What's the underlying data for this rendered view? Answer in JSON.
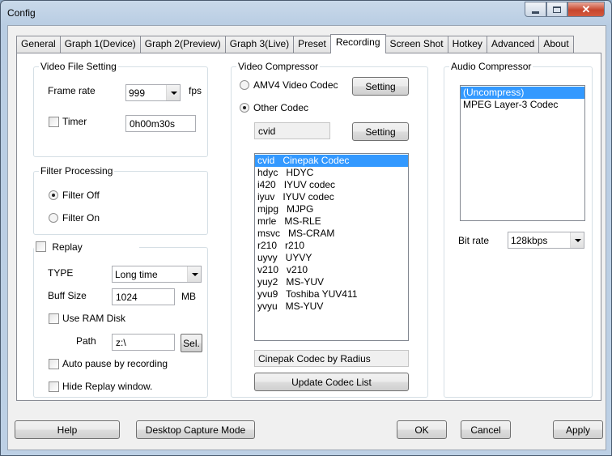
{
  "window": {
    "title": "Config",
    "close_glyph": "✕",
    "colors": {
      "selection": "#3399ff",
      "close_button": "#c7462d"
    }
  },
  "tabs": [
    {
      "label": "General"
    },
    {
      "label": "Graph 1(Device)"
    },
    {
      "label": "Graph 2(Preview)"
    },
    {
      "label": "Graph 3(Live)"
    },
    {
      "label": "Preset"
    },
    {
      "label": "Recording"
    },
    {
      "label": "Screen Shot"
    },
    {
      "label": "Hotkey"
    },
    {
      "label": "Advanced"
    },
    {
      "label": "About"
    }
  ],
  "video_file": {
    "title": "Video File Setting",
    "frame_rate_label": "Frame rate",
    "frame_rate_value": "999",
    "fps_label": "fps",
    "timer_label": "Timer",
    "timer_checked": false,
    "timer_value": "0h00m30s"
  },
  "filter": {
    "title": "Filter Processing",
    "off_label": "Filter Off",
    "on_label": "Filter On",
    "selected": "off"
  },
  "replay": {
    "title": "Replay",
    "checked": false,
    "type_label": "TYPE",
    "type_value": "Long time",
    "buff_label": "Buff Size",
    "buff_value": "1024",
    "buff_unit": "MB",
    "ram_disk_label": "Use RAM Disk",
    "path_label": "Path",
    "path_value": "z:\\",
    "sel_label": "Sel.",
    "auto_pause_label": "Auto pause by recording",
    "hide_label": "Hide Replay window."
  },
  "video_compressor": {
    "title": "Video Compressor",
    "amv4_label": "AMV4 Video Codec",
    "other_label": "Other Codec",
    "selected": "other",
    "setting1": "Setting",
    "setting2": "Setting",
    "codec_value": "cvid",
    "codecs": [
      "cvid   Cinepak Codec",
      "hdyc   HDYC",
      "i420   IYUV codec",
      "iyuv   IYUV codec",
      "mjpg   MJPG",
      "mrle   MS-RLE",
      "msvc   MS-CRAM",
      "r210   r210",
      "uyvy   UYVY",
      "v210   v210",
      "yuy2   MS-YUV",
      "yvu9   Toshiba YUV411",
      "yvyu   MS-YUV"
    ],
    "selected_index": 0,
    "description": "Cinepak Codec by Radius",
    "update_label": "Update Codec List"
  },
  "audio_compressor": {
    "title": "Audio Compressor",
    "items": [
      "(Uncompress)",
      "MPEG Layer-3 Codec"
    ],
    "selected_index": 0,
    "bitrate_label": "Bit rate",
    "bitrate_value": "128kbps"
  },
  "footer": {
    "help": "Help",
    "desktop": "Desktop Capture Mode",
    "ok": "OK",
    "cancel": "Cancel",
    "apply": "Apply"
  }
}
